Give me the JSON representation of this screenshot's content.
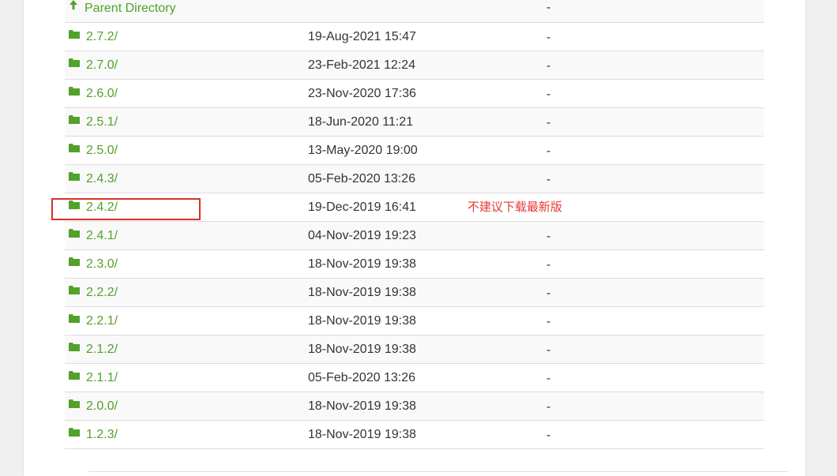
{
  "listing": {
    "parent": {
      "label": "Parent Directory",
      "size": "-",
      "icon": "arrow-up-icon"
    },
    "rows": [
      {
        "name": "2.7.2/",
        "date": "19-Aug-2021 15:47",
        "size": "-"
      },
      {
        "name": "2.7.0/",
        "date": "23-Feb-2021 12:24",
        "size": "-"
      },
      {
        "name": "2.6.0/",
        "date": "23-Nov-2020 17:36",
        "size": "-"
      },
      {
        "name": "2.5.1/",
        "date": "18-Jun-2020 11:21",
        "size": "-"
      },
      {
        "name": "2.5.0/",
        "date": "13-May-2020 19:00",
        "size": "-"
      },
      {
        "name": "2.4.3/",
        "date": "05-Feb-2020 13:26",
        "size": "-"
      },
      {
        "name": "2.4.2/",
        "date": "19-Dec-2019 16:41",
        "size": "",
        "note": "不建议下载最新版"
      },
      {
        "name": "2.4.1/",
        "date": "04-Nov-2019 19:23",
        "size": "-"
      },
      {
        "name": "2.3.0/",
        "date": "18-Nov-2019 19:38",
        "size": "-"
      },
      {
        "name": "2.2.2/",
        "date": "18-Nov-2019 19:38",
        "size": "-"
      },
      {
        "name": "2.2.1/",
        "date": "18-Nov-2019 19:38",
        "size": "-"
      },
      {
        "name": "2.1.2/",
        "date": "18-Nov-2019 19:38",
        "size": "-"
      },
      {
        "name": "2.1.1/",
        "date": "05-Feb-2020 13:26",
        "size": "-"
      },
      {
        "name": "2.0.0/",
        "date": "18-Nov-2019 19:38",
        "size": "-"
      },
      {
        "name": "1.2.3/",
        "date": "18-Nov-2019 19:38",
        "size": "-"
      }
    ]
  },
  "colors": {
    "link": "#52a229",
    "annotation": "#e53935",
    "highlight": "#d93025",
    "row_alt": "#f9f9f9",
    "divider": "#dddddd"
  },
  "icons": {
    "folder": "folder-icon",
    "parent": "arrow-up-icon"
  }
}
